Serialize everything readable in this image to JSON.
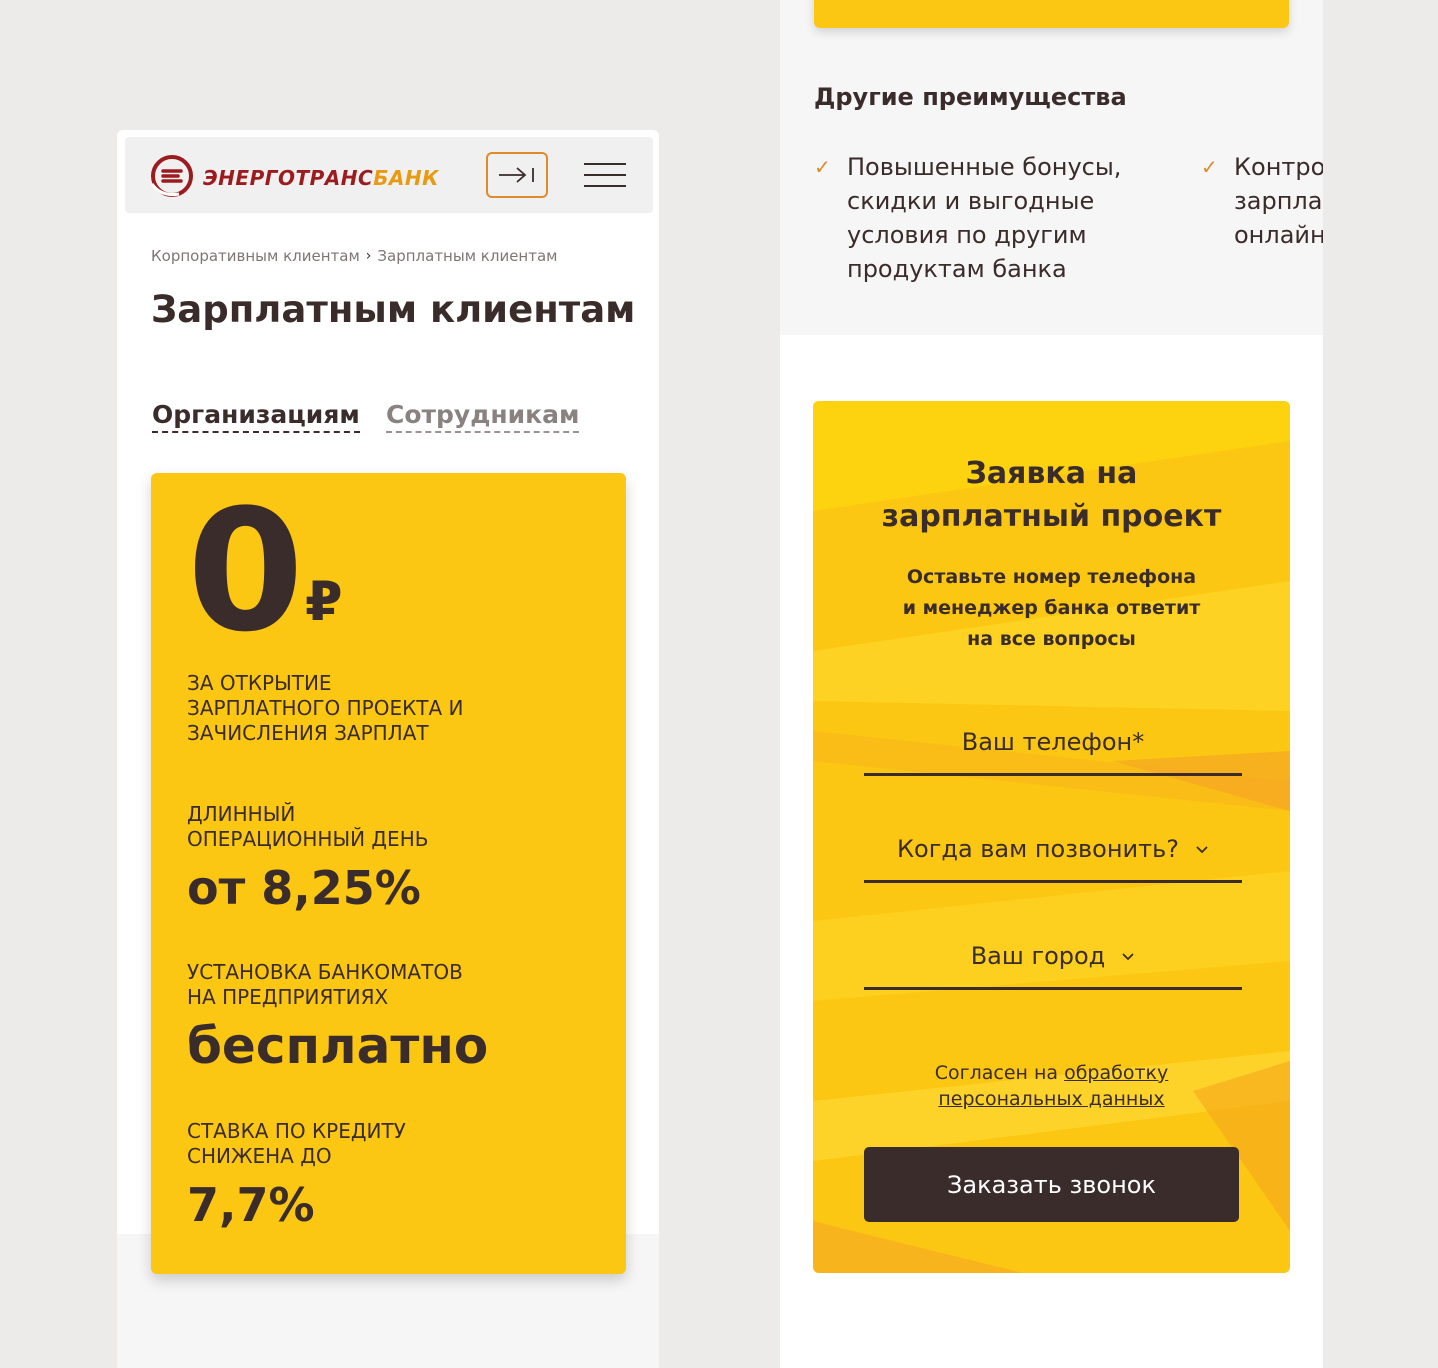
{
  "colors": {
    "brand_yellow": "#fcc712",
    "dark_text": "#3a2c2a",
    "accent_orange": "#e08a2a",
    "logo_red": "#9c1b1e"
  },
  "left": {
    "logo": {
      "text_part1": "ЭНЕРГОТРАНС",
      "text_part2": "БАНК",
      "icon": "bank-e-logo-icon"
    },
    "login_icon": "login-arrow-icon",
    "menu_icon": "hamburger-menu-icon",
    "breadcrumb": {
      "item1": "Корпоративным клиентам",
      "separator": "›",
      "item2": "Зарплатным клиентам"
    },
    "title": "Зарплатным клиентам",
    "tabs": [
      {
        "label": "Организациям",
        "active": true
      },
      {
        "label": "Сотрудникам",
        "active": false
      }
    ],
    "promo": {
      "zero": "0",
      "currency": "₽",
      "caption1": "За открытие зарплатного проекта и зачисления зарплат",
      "caption2": "Длинный операционный день",
      "value2": "от 8,25%",
      "caption3": "Установка банкоматов на предприятиях",
      "value3": "бесплатно",
      "caption4": "Ставка по кредиту снижена до",
      "value4": "7,7%"
    }
  },
  "right": {
    "advantages_title": "Другие преимущества",
    "advantages": [
      {
        "text": "Повышенные бонусы, скидки и выгодные условия по другим продуктам банка"
      },
      {
        "text": "Контро зарпла онлайн"
      }
    ],
    "form": {
      "title": "Заявка на зарплатный проект",
      "subtitle_line1": "Оставьте номер телефона",
      "subtitle_line2": "и менеджер банка ответит",
      "subtitle_line3": "на все вопросы",
      "phone_placeholder": "Ваш телефон*",
      "call_time_placeholder": "Когда вам позвонить?",
      "city_placeholder": "Ваш город",
      "consent_text": "Согласен на ",
      "consent_link": "обработку персональных данных",
      "submit_label": "Заказать звонок"
    }
  }
}
